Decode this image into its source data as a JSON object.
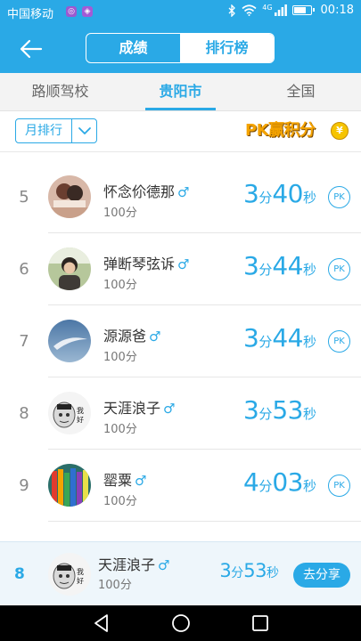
{
  "status_bar": {
    "carrier": "中国移动",
    "network": "4G",
    "battery_level": 0.75,
    "time": "00:18"
  },
  "header": {
    "back_icon": "back-arrow-icon",
    "segments": [
      {
        "label": "成绩",
        "selected": false
      },
      {
        "label": "排行榜",
        "selected": true
      }
    ]
  },
  "tabs": [
    {
      "label": "路顺驾校",
      "active": false
    },
    {
      "label": "贵阳市",
      "active": true
    },
    {
      "label": "全国",
      "active": false
    }
  ],
  "filter": {
    "period_label": "月排行",
    "pk_banner": {
      "text": "PK赢积分",
      "coin": "¥"
    }
  },
  "list": [
    {
      "rank": "5",
      "name": "怀念伱德那",
      "gender": "♂",
      "score": "100分",
      "time_min": "3",
      "min_unit": "分",
      "time_sec": "40",
      "sec_unit": "秒",
      "pk": "PK",
      "avatar": "avatar-couple"
    },
    {
      "rank": "6",
      "name": "弹断琴弦诉",
      "gender": "♂",
      "score": "100分",
      "time_min": "3",
      "min_unit": "分",
      "time_sec": "44",
      "sec_unit": "秒",
      "pk": "PK",
      "avatar": "avatar-boy-outdoor"
    },
    {
      "rank": "7",
      "name": "源源爸",
      "gender": "♂",
      "score": "100分",
      "time_min": "3",
      "min_unit": "分",
      "time_sec": "44",
      "sec_unit": "秒",
      "pk": "PK",
      "avatar": "avatar-sky"
    },
    {
      "rank": "8",
      "name": "天涯浪子",
      "gender": "♂",
      "score": "100分",
      "time_min": "3",
      "min_unit": "分",
      "time_sec": "53",
      "sec_unit": "秒",
      "pk": "",
      "avatar": "avatar-meme"
    },
    {
      "rank": "9",
      "name": "罂粟",
      "gender": "♂",
      "score": "100分",
      "time_min": "4",
      "min_unit": "分",
      "time_sec": "03",
      "sec_unit": "秒",
      "pk": "PK",
      "avatar": "avatar-pencils"
    }
  ],
  "my_rank": {
    "rank": "8",
    "name": "天涯浪子",
    "gender": "♂",
    "score": "100分",
    "time_min": "3",
    "min_unit": "分",
    "time_sec": "53",
    "sec_unit": "秒",
    "share_label": "去分享",
    "avatar": "avatar-meme"
  },
  "colors": {
    "accent": "#2aa9e6",
    "pk_gold": "#f4a300"
  }
}
